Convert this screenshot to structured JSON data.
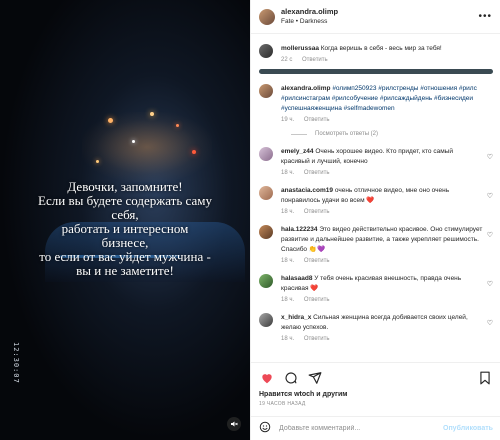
{
  "video": {
    "overlay_lines": [
      "Девочки, запомните!",
      "Если вы будете содержать саму",
      "себя,",
      "работать и интересном",
      "бизнесе,",
      "то если от вас уйдет мужчина -",
      "вы и не заметите!"
    ],
    "timestamp": "12:30:07",
    "mute_icon": "speaker-muted-icon"
  },
  "post_header": {
    "username": "alexandra.olimp",
    "audio_track": "Fate • Darkness",
    "more_icon": "more-horizontal-icon"
  },
  "top_comment": {
    "username": "mollerussaa",
    "text": "Когда веришь в себя - весь мир за тебя!",
    "time": "22 с",
    "reply_label": "Ответить"
  },
  "caption": {
    "username": "alexandra.olimp",
    "hashtags": "#олимп250923 #рилстренды #отношения #рилс #рилсинстаграм #рилсобучение #рилсаждыйдень #бизнесидеи #успешнаяженщина #selfmadewomen",
    "time": "19 ч.",
    "reply_label": "Ответить",
    "view_replies_label": "Посмотреть ответы (2)"
  },
  "comments": [
    {
      "username": "emely_z44",
      "text": "Очень хорошее видео. Кто придет, кто самый красивый и лучший, конечно",
      "time": "18 ч.",
      "reply_label": "Ответить"
    },
    {
      "username": "anastacia.com19",
      "text": "очень отличное видео, мне оно очень понравилось удачи во всем",
      "emoji": "❤️",
      "time": "18 ч.",
      "reply_label": "Ответить"
    },
    {
      "username": "hala.122234",
      "text": "Это видео действительно красивое. Оно стимулирует развитие и дальнейшее развитие, а также укрепляет решимость. Спасибо",
      "emoji": "👏💜",
      "time": "18 ч.",
      "reply_label": "Ответить"
    },
    {
      "username": "halasaad8",
      "text": "У тебя очень красивая внешность, правда очень красивая",
      "emoji": "❤️",
      "time": "18 ч.",
      "reply_label": "Ответить"
    },
    {
      "username": "x_hidra_x",
      "text": "Сильная женщина всегда добивается своих целей, желаю успехов.",
      "time": "18 ч.",
      "reply_label": "Ответить"
    }
  ],
  "actions": {
    "like_icon": "heart-filled-icon",
    "comment_icon": "comment-icon",
    "share_icon": "share-paper-plane-icon",
    "save_icon": "bookmark-icon",
    "liked_by": "Нравится wtoch и другим",
    "time_ago": "19 ЧАСОВ НАЗАД"
  },
  "add_comment": {
    "emoji_icon": "smiley-icon",
    "placeholder": "Добавьте комментарий...",
    "post_label": "Опубликовать"
  },
  "colors": {
    "like_red": "#ed4956",
    "link_blue": "#00376b",
    "post_disabled": "#b2dffc",
    "muted_text": "#8e8e8e"
  }
}
